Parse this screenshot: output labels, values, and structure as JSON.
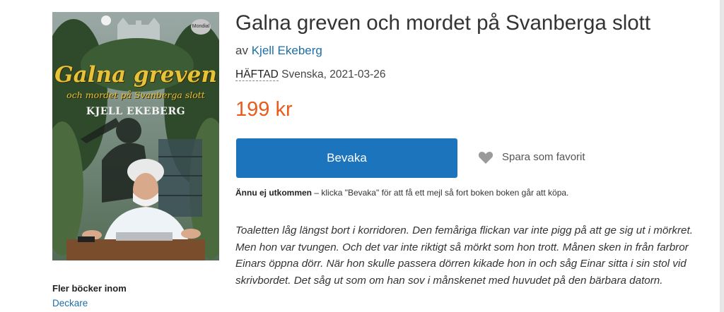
{
  "book": {
    "title": "Galna greven och mordet på Svanberga slott",
    "by_prefix": "av",
    "author": "Kjell Ekeberg",
    "format": "HÄFTAD",
    "language_date": "Svenska, 2021-03-26",
    "price": "199 kr"
  },
  "cover": {
    "title": "Galna greven",
    "subtitle": "och mordet på Svanberga slott",
    "author": "KJELL EKEBERG",
    "publisher_logo": "Mondial"
  },
  "actions": {
    "watch_label": "Bevaka",
    "favorite_label": "Spara som favorit",
    "favorite_icon": "heart-icon"
  },
  "notice": {
    "bold": "Ännu ej utkommen",
    "text": " – klicka \"Bevaka\" för att få ett mejl så fort boken boken går att köpa."
  },
  "excerpt": "Toaletten låg längst bort i korridoren. Den femåriga flickan var inte pigg på att ge sig ut i mörkret. Men hon var tvungen. Och det var inte riktigt så mörkt som hon trott. Månen sken in från farbror Einars öppna dörr. När hon skulle passera dörren kikade hon in och såg Einar sitta i sin stol vid skrivbordet. Det såg ut som om han sov i månskenet med huvudet på den bärbara datorn.",
  "more_books": {
    "label": "Fler böcker inom",
    "category": "Deckare"
  },
  "colors": {
    "accent_blue": "#1c75bc",
    "link_blue": "#1d6ea8",
    "price_orange": "#ea5a1a",
    "cover_gold": "#e4c23a"
  }
}
